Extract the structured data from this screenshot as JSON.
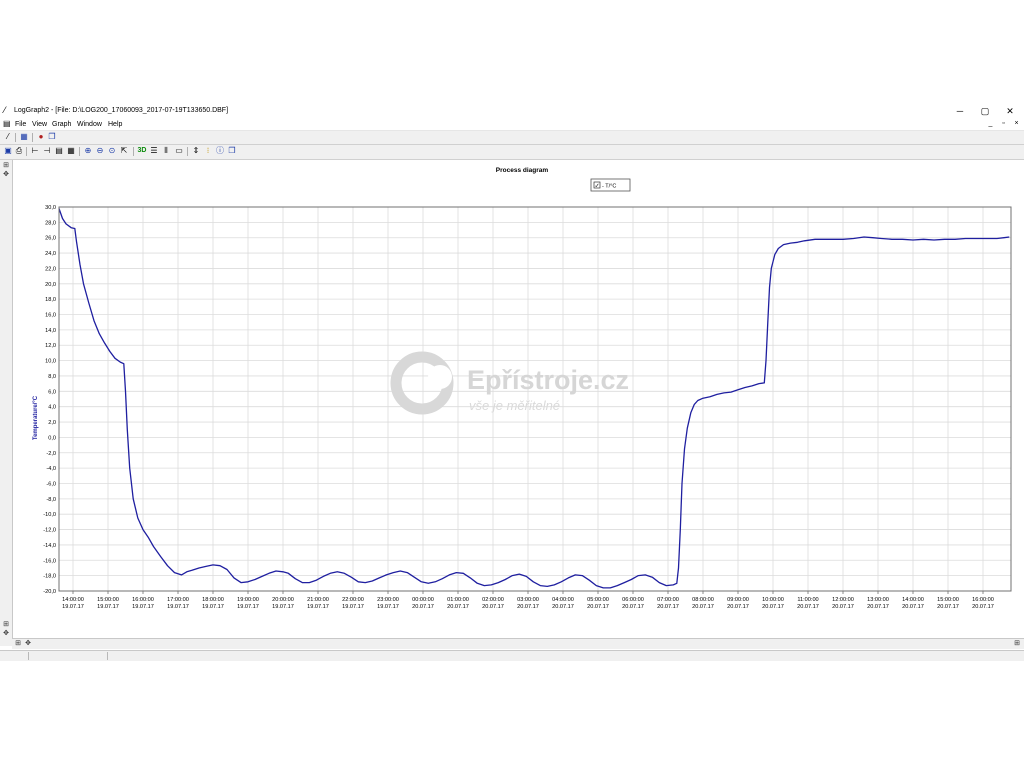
{
  "window": {
    "title": "LogGraph2 - [File: D:\\LOG200_17060093_2017-07-19T133650.DBF]",
    "controls": [
      "─",
      "▢",
      "✕"
    ]
  },
  "menu": {
    "items": [
      "File",
      "View",
      "Graph",
      "Window",
      "Help"
    ],
    "mdi_controls": [
      "_",
      "▫",
      "×"
    ]
  },
  "chart_data": {
    "type": "line",
    "title": "Process diagram",
    "ylabel": "Temperature/°C",
    "xlabel": "",
    "legend": {
      "label": "- T/°C",
      "checked": true,
      "placement": "top-center"
    },
    "ylim": [
      -20,
      30
    ],
    "ytick_labels": [
      "30,0",
      "28,0",
      "26,0",
      "24,0",
      "22,0",
      "20,0",
      "18,0",
      "16,0",
      "14,0",
      "12,0",
      "10,0",
      "8,0",
      "6,0",
      "4,0",
      "2,0",
      "0,0",
      "-2,0",
      "-4,0",
      "-6,0",
      "-8,0",
      "-10,0",
      "-12,0",
      "-14,0",
      "-16,0",
      "-18,0",
      "-20,0"
    ],
    "xlim": [
      13.6,
      40.8
    ],
    "xticks": [
      {
        "t": "14:00:00",
        "d": "19.07.17"
      },
      {
        "t": "15:00:00",
        "d": "19.07.17"
      },
      {
        "t": "16:00:00",
        "d": "19.07.17"
      },
      {
        "t": "17:00:00",
        "d": "19.07.17"
      },
      {
        "t": "18:00:00",
        "d": "19.07.17"
      },
      {
        "t": "19:00:00",
        "d": "19.07.17"
      },
      {
        "t": "20:00:00",
        "d": "19.07.17"
      },
      {
        "t": "21:00:00",
        "d": "19.07.17"
      },
      {
        "t": "22:00:00",
        "d": "19.07.17"
      },
      {
        "t": "23:00:00",
        "d": "19.07.17"
      },
      {
        "t": "00:00:00",
        "d": "20.07.17"
      },
      {
        "t": "01:00:00",
        "d": "20.07.17"
      },
      {
        "t": "02:00:00",
        "d": "20.07.17"
      },
      {
        "t": "03:00:00",
        "d": "20.07.17"
      },
      {
        "t": "04:00:00",
        "d": "20.07.17"
      },
      {
        "t": "05:00:00",
        "d": "20.07.17"
      },
      {
        "t": "06:00:00",
        "d": "20.07.17"
      },
      {
        "t": "07:00:00",
        "d": "20.07.17"
      },
      {
        "t": "08:00:00",
        "d": "20.07.17"
      },
      {
        "t": "09:00:00",
        "d": "20.07.17"
      },
      {
        "t": "10:00:00",
        "d": "20.07.17"
      },
      {
        "t": "11:00:00",
        "d": "20.07.17"
      },
      {
        "t": "12:00:00",
        "d": "20.07.17"
      },
      {
        "t": "13:00:00",
        "d": "20.07.17"
      },
      {
        "t": "14:00:00",
        "d": "20.07.17"
      },
      {
        "t": "15:00:00",
        "d": "20.07.17"
      },
      {
        "t": "16:00:00",
        "d": "20.07.17"
      }
    ],
    "grid": true,
    "line_color": "#1f1fa0",
    "series": [
      {
        "name": "T/°C",
        "points": [
          [
            13.6,
            29.8
          ],
          [
            13.7,
            28.5
          ],
          [
            13.8,
            27.8
          ],
          [
            13.95,
            27.3
          ],
          [
            14.05,
            27.2
          ],
          [
            14.1,
            25.5
          ],
          [
            14.2,
            22.5
          ],
          [
            14.3,
            20.0
          ],
          [
            14.45,
            17.5
          ],
          [
            14.6,
            15.2
          ],
          [
            14.75,
            13.5
          ],
          [
            14.9,
            12.3
          ],
          [
            15.05,
            11.2
          ],
          [
            15.2,
            10.3
          ],
          [
            15.35,
            9.8
          ],
          [
            15.45,
            9.6
          ],
          [
            15.5,
            6.0
          ],
          [
            15.55,
            1.0
          ],
          [
            15.62,
            -4.0
          ],
          [
            15.72,
            -8.0
          ],
          [
            15.85,
            -10.5
          ],
          [
            16.0,
            -12.0
          ],
          [
            16.15,
            -13.0
          ],
          [
            16.3,
            -14.2
          ],
          [
            16.5,
            -15.5
          ],
          [
            16.7,
            -16.7
          ],
          [
            16.9,
            -17.6
          ],
          [
            17.1,
            -17.9
          ],
          [
            17.25,
            -17.5
          ],
          [
            17.4,
            -17.3
          ],
          [
            17.6,
            -17.0
          ],
          [
            17.8,
            -16.8
          ],
          [
            18.0,
            -16.6
          ],
          [
            18.2,
            -16.7
          ],
          [
            18.4,
            -17.2
          ],
          [
            18.6,
            -18.3
          ],
          [
            18.8,
            -18.9
          ],
          [
            19.0,
            -18.8
          ],
          [
            19.2,
            -18.5
          ],
          [
            19.4,
            -18.1
          ],
          [
            19.6,
            -17.7
          ],
          [
            19.8,
            -17.4
          ],
          [
            20.0,
            -17.5
          ],
          [
            20.15,
            -17.7
          ],
          [
            20.35,
            -18.4
          ],
          [
            20.55,
            -18.9
          ],
          [
            20.75,
            -18.9
          ],
          [
            20.95,
            -18.6
          ],
          [
            21.15,
            -18.1
          ],
          [
            21.35,
            -17.7
          ],
          [
            21.55,
            -17.5
          ],
          [
            21.75,
            -17.7
          ],
          [
            21.95,
            -18.2
          ],
          [
            22.15,
            -18.8
          ],
          [
            22.35,
            -18.9
          ],
          [
            22.55,
            -18.7
          ],
          [
            22.75,
            -18.3
          ],
          [
            22.95,
            -17.9
          ],
          [
            23.15,
            -17.6
          ],
          [
            23.35,
            -17.4
          ],
          [
            23.55,
            -17.6
          ],
          [
            23.75,
            -18.2
          ],
          [
            23.95,
            -18.8
          ],
          [
            24.15,
            -19.0
          ],
          [
            24.35,
            -18.8
          ],
          [
            24.55,
            -18.4
          ],
          [
            24.75,
            -17.9
          ],
          [
            24.95,
            -17.6
          ],
          [
            25.15,
            -17.7
          ],
          [
            25.35,
            -18.3
          ],
          [
            25.55,
            -19.0
          ],
          [
            25.75,
            -19.3
          ],
          [
            25.95,
            -19.2
          ],
          [
            26.15,
            -18.9
          ],
          [
            26.35,
            -18.5
          ],
          [
            26.55,
            -18.0
          ],
          [
            26.75,
            -17.8
          ],
          [
            26.95,
            -18.1
          ],
          [
            27.15,
            -18.8
          ],
          [
            27.35,
            -19.3
          ],
          [
            27.55,
            -19.4
          ],
          [
            27.75,
            -19.2
          ],
          [
            27.95,
            -18.8
          ],
          [
            28.15,
            -18.3
          ],
          [
            28.35,
            -17.9
          ],
          [
            28.55,
            -18.0
          ],
          [
            28.75,
            -18.6
          ],
          [
            28.95,
            -19.3
          ],
          [
            29.15,
            -19.6
          ],
          [
            29.35,
            -19.6
          ],
          [
            29.55,
            -19.3
          ],
          [
            29.75,
            -18.9
          ],
          [
            29.95,
            -18.5
          ],
          [
            30.15,
            -18.0
          ],
          [
            30.35,
            -17.9
          ],
          [
            30.55,
            -18.2
          ],
          [
            30.75,
            -18.9
          ],
          [
            30.95,
            -19.3
          ],
          [
            31.15,
            -19.2
          ],
          [
            31.25,
            -19.0
          ],
          [
            31.3,
            -17.0
          ],
          [
            31.35,
            -12.0
          ],
          [
            31.4,
            -6.0
          ],
          [
            31.47,
            -1.5
          ],
          [
            31.55,
            1.2
          ],
          [
            31.65,
            3.2
          ],
          [
            31.75,
            4.3
          ],
          [
            31.85,
            4.8
          ],
          [
            32.0,
            5.1
          ],
          [
            32.2,
            5.3
          ],
          [
            32.4,
            5.6
          ],
          [
            32.6,
            5.8
          ],
          [
            32.8,
            5.9
          ],
          [
            33.0,
            6.2
          ],
          [
            33.2,
            6.5
          ],
          [
            33.4,
            6.7
          ],
          [
            33.6,
            7.0
          ],
          [
            33.75,
            7.1
          ],
          [
            33.8,
            10.0
          ],
          [
            33.85,
            15.0
          ],
          [
            33.9,
            19.5
          ],
          [
            33.95,
            22.0
          ],
          [
            34.05,
            23.8
          ],
          [
            34.15,
            24.6
          ],
          [
            34.3,
            25.1
          ],
          [
            34.5,
            25.3
          ],
          [
            34.7,
            25.4
          ],
          [
            34.9,
            25.6
          ],
          [
            35.2,
            25.8
          ],
          [
            35.6,
            25.8
          ],
          [
            36.0,
            25.8
          ],
          [
            36.3,
            25.9
          ],
          [
            36.6,
            26.1
          ],
          [
            36.85,
            26.0
          ],
          [
            37.1,
            25.9
          ],
          [
            37.4,
            25.8
          ],
          [
            37.7,
            25.8
          ],
          [
            38.0,
            25.7
          ],
          [
            38.3,
            25.8
          ],
          [
            38.6,
            25.7
          ],
          [
            38.9,
            25.8
          ],
          [
            39.2,
            25.8
          ],
          [
            39.5,
            25.9
          ],
          [
            39.8,
            25.9
          ],
          [
            40.1,
            25.9
          ],
          [
            40.4,
            25.9
          ],
          [
            40.6,
            26.0
          ],
          [
            40.75,
            26.1
          ]
        ]
      }
    ]
  },
  "watermark": {
    "brand": "Epřístroje.cz",
    "tagline": "vše je měřitelné"
  }
}
